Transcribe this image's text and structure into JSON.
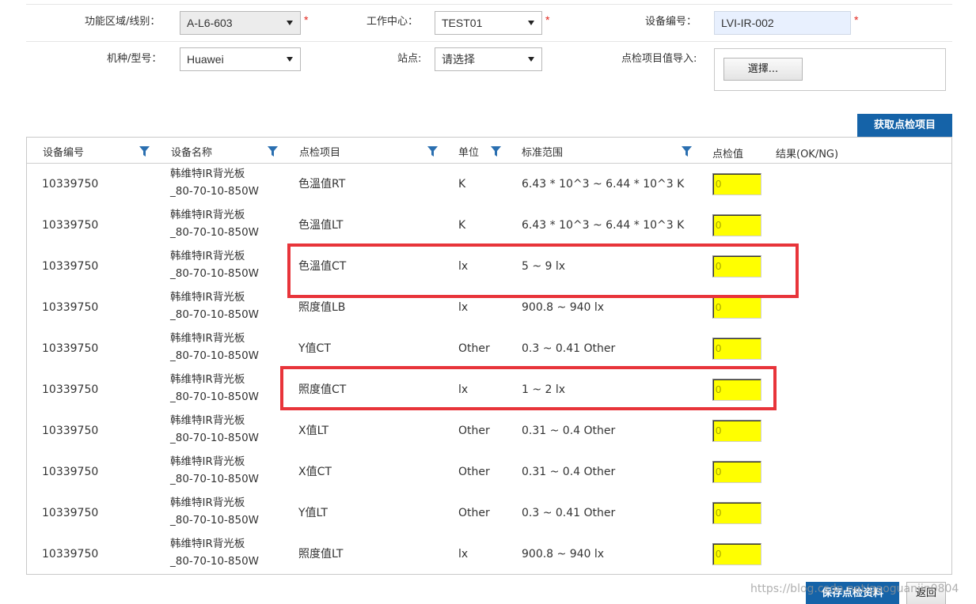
{
  "form": {
    "area": {
      "label": "功能区域/线别：",
      "value": "A-L6-603",
      "required_mark": "*"
    },
    "work_center": {
      "label": "工作中心：",
      "value": "TEST01",
      "required_mark": "*"
    },
    "equipment_no": {
      "label": "设备编号：",
      "value": "LVI-IR-002",
      "required_mark": "*"
    },
    "model": {
      "label": "机种/型号：",
      "value": "Huawei"
    },
    "station": {
      "label": "站点:",
      "value": "请选择"
    },
    "import": {
      "label": "点检项目值导入:",
      "choose_label": "選擇..."
    }
  },
  "fetch_button_label": "获取点检项目",
  "grid": {
    "columns": {
      "equipment_no": "设备编号",
      "equipment_name": "设备名称",
      "check_item": "点检项目",
      "unit": "单位",
      "standard_range": "标准范围",
      "check_value": "点检值",
      "result": "结果(OK/NG)"
    },
    "rows": [
      {
        "equipment_no": "10339750",
        "name_line1": "韩维特IR背光板",
        "name_line2": "_80-70-10-850W",
        "check_item": "色溫值RT",
        "unit": "K",
        "range": "6.43 * 10^3 ~ 6.44 * 10^3 K",
        "value": "0"
      },
      {
        "equipment_no": "10339750",
        "name_line1": "韩维特IR背光板",
        "name_line2": "_80-70-10-850W",
        "check_item": "色溫值LT",
        "unit": "K",
        "range": "6.43 * 10^3 ~ 6.44 * 10^3 K",
        "value": "0"
      },
      {
        "equipment_no": "10339750",
        "name_line1": "韩维特IR背光板",
        "name_line2": "_80-70-10-850W",
        "check_item": "色溫值CT",
        "unit": "lx",
        "range": "5 ~ 9 lx",
        "value": "0"
      },
      {
        "equipment_no": "10339750",
        "name_line1": "韩维特IR背光板",
        "name_line2": "_80-70-10-850W",
        "check_item": "照度值LB",
        "unit": "lx",
        "range": "900.8 ~ 940 lx",
        "value": "0"
      },
      {
        "equipment_no": "10339750",
        "name_line1": "韩维特IR背光板",
        "name_line2": "_80-70-10-850W",
        "check_item": "Y值CT",
        "unit": "Other",
        "range": "0.3 ~ 0.41 Other",
        "value": "0"
      },
      {
        "equipment_no": "10339750",
        "name_line1": "韩维特IR背光板",
        "name_line2": "_80-70-10-850W",
        "check_item": "照度值CT",
        "unit": "lx",
        "range": "1 ~ 2 lx",
        "value": "0"
      },
      {
        "equipment_no": "10339750",
        "name_line1": "韩维特IR背光板",
        "name_line2": "_80-70-10-850W",
        "check_item": "X值LT",
        "unit": "Other",
        "range": "0.31 ~ 0.4 Other",
        "value": "0"
      },
      {
        "equipment_no": "10339750",
        "name_line1": "韩维特IR背光板",
        "name_line2": "_80-70-10-850W",
        "check_item": "X值CT",
        "unit": "Other",
        "range": "0.31 ~ 0.4 Other",
        "value": "0"
      },
      {
        "equipment_no": "10339750",
        "name_line1": "韩维特IR背光板",
        "name_line2": "_80-70-10-850W",
        "check_item": "Y值LT",
        "unit": "Other",
        "range": "0.3 ~ 0.41 Other",
        "value": "0"
      },
      {
        "equipment_no": "10339750",
        "name_line1": "韩维特IR背光板",
        "name_line2": "_80-70-10-850W",
        "check_item": "照度值LT",
        "unit": "lx",
        "range": "900.8 ~ 940 lx",
        "value": "0"
      }
    ]
  },
  "footer": {
    "save_label": "保存点检资料",
    "back_label": "返回",
    "watermark": "https://blog.csdn.net/gaoguanjin0804"
  },
  "icons": {
    "filter": "filter-funnel-icon",
    "dropdown": "chevron-down-icon"
  },
  "colors": {
    "accent_blue": "#1563a8",
    "required_red": "#e2231a",
    "highlight_red": "#e8343a",
    "input_yellow": "#ffff00",
    "filter_icon": "#2a6fb0"
  }
}
